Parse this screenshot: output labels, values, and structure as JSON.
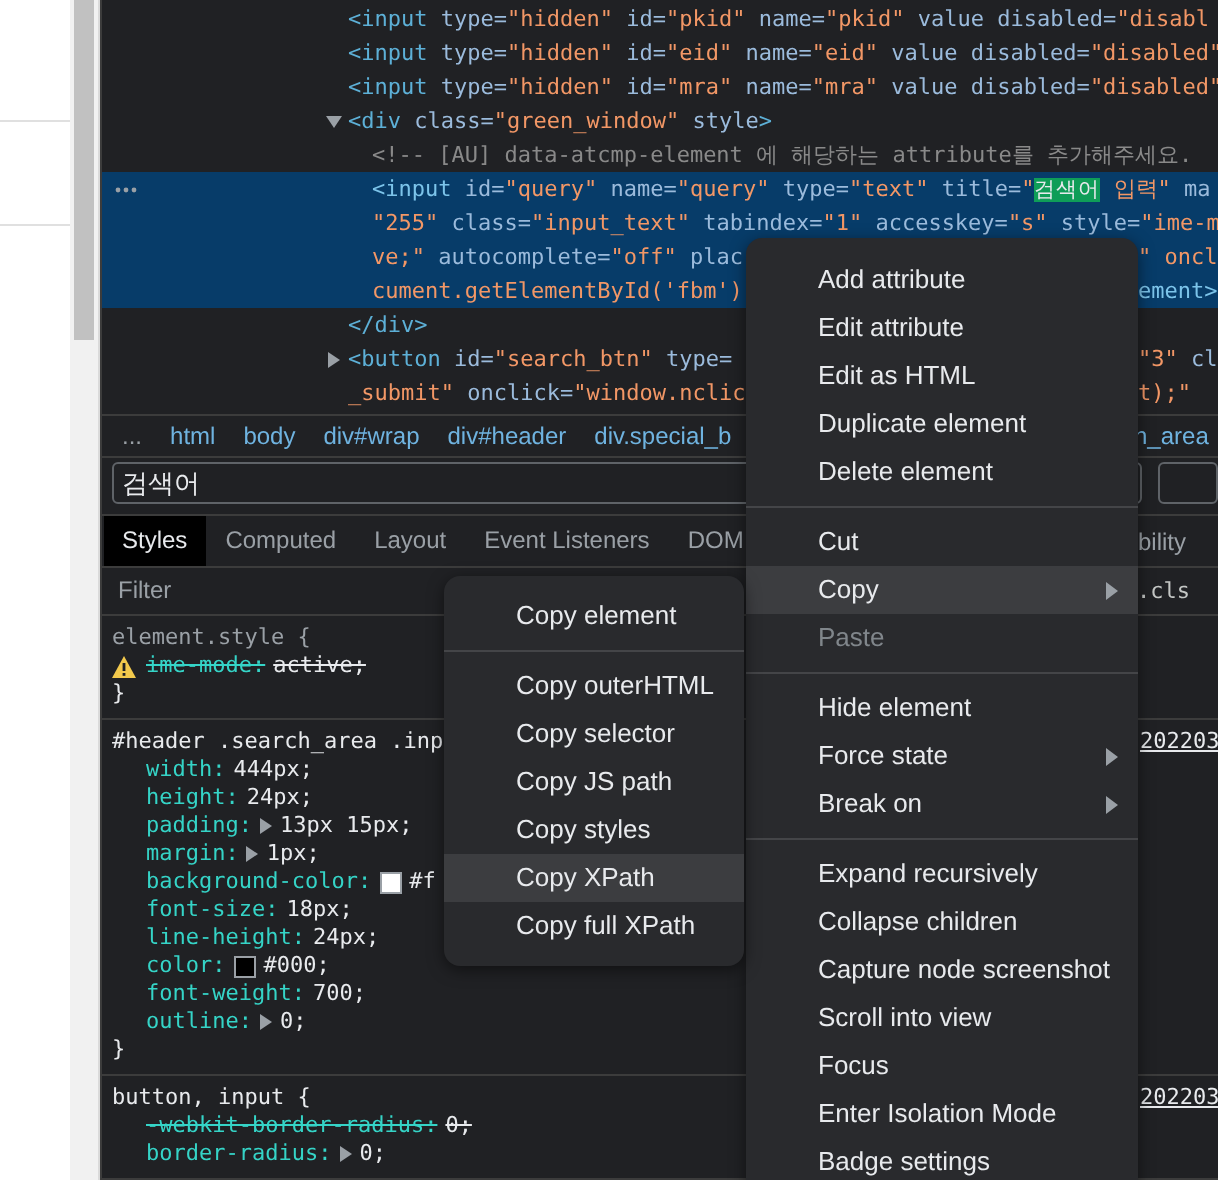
{
  "elements": {
    "nodes": [
      {
        "selected": false,
        "lines": [
          {
            "segs": [
              {
                "kind": "t",
                "s": "<input "
              },
              {
                "kind": "a",
                "s": "type="
              },
              {
                "kind": "v",
                "s": "\"hidden\""
              },
              {
                "kind": "a",
                "s": " id="
              },
              {
                "kind": "v",
                "s": "\"pkid\""
              },
              {
                "kind": "a",
                "s": " name="
              },
              {
                "kind": "v",
                "s": "\"pkid\""
              },
              {
                "kind": "a",
                "s": " value disabled="
              },
              {
                "kind": "v",
                "s": "\"disabl"
              }
            ]
          }
        ]
      },
      {
        "selected": false,
        "lines": [
          {
            "segs": [
              {
                "kind": "t",
                "s": "<input "
              },
              {
                "kind": "a",
                "s": "type="
              },
              {
                "kind": "v",
                "s": "\"hidden\""
              },
              {
                "kind": "a",
                "s": " id="
              },
              {
                "kind": "v",
                "s": "\"eid\""
              },
              {
                "kind": "a",
                "s": " name="
              },
              {
                "kind": "v",
                "s": "\"eid\""
              },
              {
                "kind": "a",
                "s": " value disabled="
              },
              {
                "kind": "v",
                "s": "\"disabled\""
              }
            ]
          }
        ]
      },
      {
        "selected": false,
        "lines": [
          {
            "segs": [
              {
                "kind": "t",
                "s": "<input "
              },
              {
                "kind": "a",
                "s": "type="
              },
              {
                "kind": "v",
                "s": "\"hidden\""
              },
              {
                "kind": "a",
                "s": " id="
              },
              {
                "kind": "v",
                "s": "\"mra\""
              },
              {
                "kind": "a",
                "s": " name="
              },
              {
                "kind": "v",
                "s": "\"mra\""
              },
              {
                "kind": "a",
                "s": " value disabled="
              },
              {
                "kind": "v",
                "s": "\"disabled\""
              }
            ]
          }
        ]
      },
      {
        "selected": false,
        "expanded": true,
        "lines": [
          {
            "segs": [
              {
                "kind": "t",
                "s": "<div "
              },
              {
                "kind": "a",
                "s": "class="
              },
              {
                "kind": "v",
                "s": "\"green_window\""
              },
              {
                "kind": "a",
                "s": " style"
              },
              {
                "kind": "t",
                "s": ">"
              }
            ]
          }
        ],
        "children": [
          {
            "selected": false,
            "lines": [
              {
                "segs": [
                  {
                    "kind": "c",
                    "s": "<!-- [AU] data-atcmp-element 에 해당하는 attribute를 추가해주세요."
                  }
                ]
              }
            ]
          },
          {
            "selected": true,
            "lines": [
              {
                "segs": [
                  {
                    "kind": "t",
                    "s": "<input "
                  },
                  {
                    "kind": "a",
                    "s": "id="
                  },
                  {
                    "kind": "v",
                    "s": "\"query\""
                  },
                  {
                    "kind": "a",
                    "s": " name="
                  },
                  {
                    "kind": "v",
                    "s": "\"query\""
                  },
                  {
                    "kind": "a",
                    "s": " type="
                  },
                  {
                    "kind": "v",
                    "s": "\"text\""
                  },
                  {
                    "kind": "a",
                    "s": " title="
                  },
                  {
                    "kind": "v",
                    "s": "\""
                  },
                  {
                    "kind": "h",
                    "s": "검색어"
                  },
                  {
                    "kind": "v",
                    "s": " 입력\""
                  },
                  {
                    "kind": "a",
                    "s": " ma"
                  }
                ]
              },
              {
                "segs": [
                  {
                    "kind": "v",
                    "s": "\"255\""
                  },
                  {
                    "kind": "a",
                    "s": " class="
                  },
                  {
                    "kind": "v",
                    "s": "\"input_text\""
                  },
                  {
                    "kind": "a",
                    "s": " tabindex="
                  },
                  {
                    "kind": "v",
                    "s": "\"1\""
                  },
                  {
                    "kind": "a",
                    "s": " accesskey="
                  },
                  {
                    "kind": "v",
                    "s": "\"s\""
                  },
                  {
                    "kind": "a",
                    "s": " style="
                  },
                  {
                    "kind": "v",
                    "s": "\"ime-m"
                  }
                ]
              },
              {
                "segs": [
                  {
                    "kind": "v",
                    "s": "ve;\""
                  },
                  {
                    "kind": "a",
                    "s": " autocomplete="
                  },
                  {
                    "kind": "v",
                    "s": "\"off\""
                  },
                  {
                    "kind": "a",
                    "s": " plac"
                  }
                ],
                "tail": [
                  {
                    "kind": "v",
                    "s": "\" oncl"
                  }
                ]
              },
              {
                "segs": [
                  {
                    "kind": "v",
                    "s": "cument.getElementById('fbm')"
                  }
                ],
                "tail": [
                  {
                    "kind": "t",
                    "s": "ement>"
                  }
                ]
              }
            ]
          }
        ]
      },
      {
        "selected": false,
        "lines": [
          {
            "segs": [
              {
                "kind": "t",
                "s": "</div>"
              }
            ]
          }
        ]
      },
      {
        "selected": false,
        "expanded": false,
        "lines": [
          {
            "segs": [
              {
                "kind": "t",
                "s": "<button "
              },
              {
                "kind": "a",
                "s": "id="
              },
              {
                "kind": "v",
                "s": "\"search_btn\""
              },
              {
                "kind": "a",
                "s": " type="
              }
            ],
            "tail": [
              {
                "kind": "v",
                "s": "\"3\""
              },
              {
                "kind": "a",
                "s": " cl"
              }
            ]
          },
          {
            "segs": [
              {
                "kind": "v",
                "s": "_submit\""
              },
              {
                "kind": "a",
                "s": " onclick="
              },
              {
                "kind": "v",
                "s": "\"window.nclic"
              }
            ],
            "tail": [
              {
                "kind": "v",
                "s": "t);\""
              }
            ]
          }
        ]
      }
    ]
  },
  "breadcrumbs": {
    "more": "...",
    "items": [
      "html",
      "body",
      "div#wrap",
      "div#header",
      "div.special_b"
    ],
    "tail": "n_area"
  },
  "search": {
    "value": "검색어"
  },
  "tabs": [
    {
      "label": "Styles",
      "selected": true
    },
    {
      "label": "Computed",
      "selected": false
    },
    {
      "label": "Layout",
      "selected": false
    },
    {
      "label": "Event Listeners",
      "selected": false
    },
    {
      "label": "DOM",
      "selected": false
    }
  ],
  "tabs_tail": "bility",
  "filter": {
    "placeholder": "Filter",
    "cls": ".cls"
  },
  "rules": [
    {
      "selector": "element.style {",
      "close": "}",
      "props": [
        {
          "name": "ime-mode:",
          "value": "active;",
          "struck": true,
          "warning": true
        }
      ]
    },
    {
      "selector": "#header .search_area .inp",
      "source": "202203",
      "close": "}",
      "props": [
        {
          "name": "width:",
          "value": "444px;",
          "struck": false
        },
        {
          "name": "height:",
          "value": "24px;",
          "struck": false
        },
        {
          "name": "padding:",
          "value": "13px 15px;",
          "struck": false,
          "arrow": true
        },
        {
          "name": "margin:",
          "value": "1px;",
          "struck": false,
          "arrow": true
        },
        {
          "name": "background-color:",
          "value": "#f",
          "color": "#ffffff",
          "struck": false
        },
        {
          "name": "font-size:",
          "value": "18px;",
          "struck": false
        },
        {
          "name": "line-height:",
          "value": "24px;",
          "struck": false
        },
        {
          "name": "color:",
          "value": "#000;",
          "color": "#000000",
          "struck": false
        },
        {
          "name": "font-weight:",
          "value": "700;",
          "struck": false
        },
        {
          "name": "outline:",
          "value": "0;",
          "struck": false,
          "arrow": true
        }
      ]
    },
    {
      "selector": "button, input {",
      "source": "202203",
      "props": [
        {
          "name": "-webkit-border-radius:",
          "value": "0;",
          "struck": true
        },
        {
          "name": "border-radius:",
          "value": "0;",
          "struck": false,
          "arrow": true
        }
      ]
    }
  ],
  "context_menu": {
    "items": [
      {
        "kind": "item",
        "label": "Add attribute",
        "hovered": false,
        "disabled": false,
        "submenu": false
      },
      {
        "kind": "item",
        "label": "Edit attribute",
        "hovered": false,
        "disabled": false,
        "submenu": false
      },
      {
        "kind": "item",
        "label": "Edit as HTML",
        "hovered": false,
        "disabled": false,
        "submenu": false
      },
      {
        "kind": "item",
        "label": "Duplicate element",
        "hovered": false,
        "disabled": false,
        "submenu": false
      },
      {
        "kind": "item",
        "label": "Delete element",
        "hovered": false,
        "disabled": false,
        "submenu": false
      },
      {
        "kind": "divider"
      },
      {
        "kind": "item",
        "label": "Cut",
        "hovered": false,
        "disabled": false,
        "submenu": false
      },
      {
        "kind": "item",
        "label": "Copy",
        "hovered": true,
        "disabled": false,
        "submenu": true
      },
      {
        "kind": "item",
        "label": "Paste",
        "hovered": false,
        "disabled": true,
        "submenu": false
      },
      {
        "kind": "divider"
      },
      {
        "kind": "item",
        "label": "Hide element",
        "hovered": false,
        "disabled": false,
        "submenu": false
      },
      {
        "kind": "item",
        "label": "Force state",
        "hovered": false,
        "disabled": false,
        "submenu": true
      },
      {
        "kind": "item",
        "label": "Break on",
        "hovered": false,
        "disabled": false,
        "submenu": true
      },
      {
        "kind": "divider"
      },
      {
        "kind": "item",
        "label": "Expand recursively",
        "hovered": false,
        "disabled": false,
        "submenu": false
      },
      {
        "kind": "item",
        "label": "Collapse children",
        "hovered": false,
        "disabled": false,
        "submenu": false
      },
      {
        "kind": "item",
        "label": "Capture node screenshot",
        "hovered": false,
        "disabled": false,
        "submenu": false
      },
      {
        "kind": "item",
        "label": "Scroll into view",
        "hovered": false,
        "disabled": false,
        "submenu": false
      },
      {
        "kind": "item",
        "label": "Focus",
        "hovered": false,
        "disabled": false,
        "submenu": false
      },
      {
        "kind": "item",
        "label": "Enter Isolation Mode",
        "hovered": false,
        "disabled": false,
        "submenu": false
      },
      {
        "kind": "item",
        "label": "Badge settings",
        "hovered": false,
        "disabled": false,
        "submenu": false
      }
    ]
  },
  "copy_submenu": {
    "items": [
      {
        "kind": "item",
        "label": "Copy element",
        "hovered": false
      },
      {
        "kind": "divider"
      },
      {
        "kind": "item",
        "label": "Copy outerHTML",
        "hovered": false
      },
      {
        "kind": "item",
        "label": "Copy selector",
        "hovered": false
      },
      {
        "kind": "item",
        "label": "Copy JS path",
        "hovered": false
      },
      {
        "kind": "item",
        "label": "Copy styles",
        "hovered": false
      },
      {
        "kind": "item",
        "label": "Copy XPath",
        "hovered": true
      },
      {
        "kind": "item",
        "label": "Copy full XPath",
        "hovered": false
      }
    ]
  }
}
